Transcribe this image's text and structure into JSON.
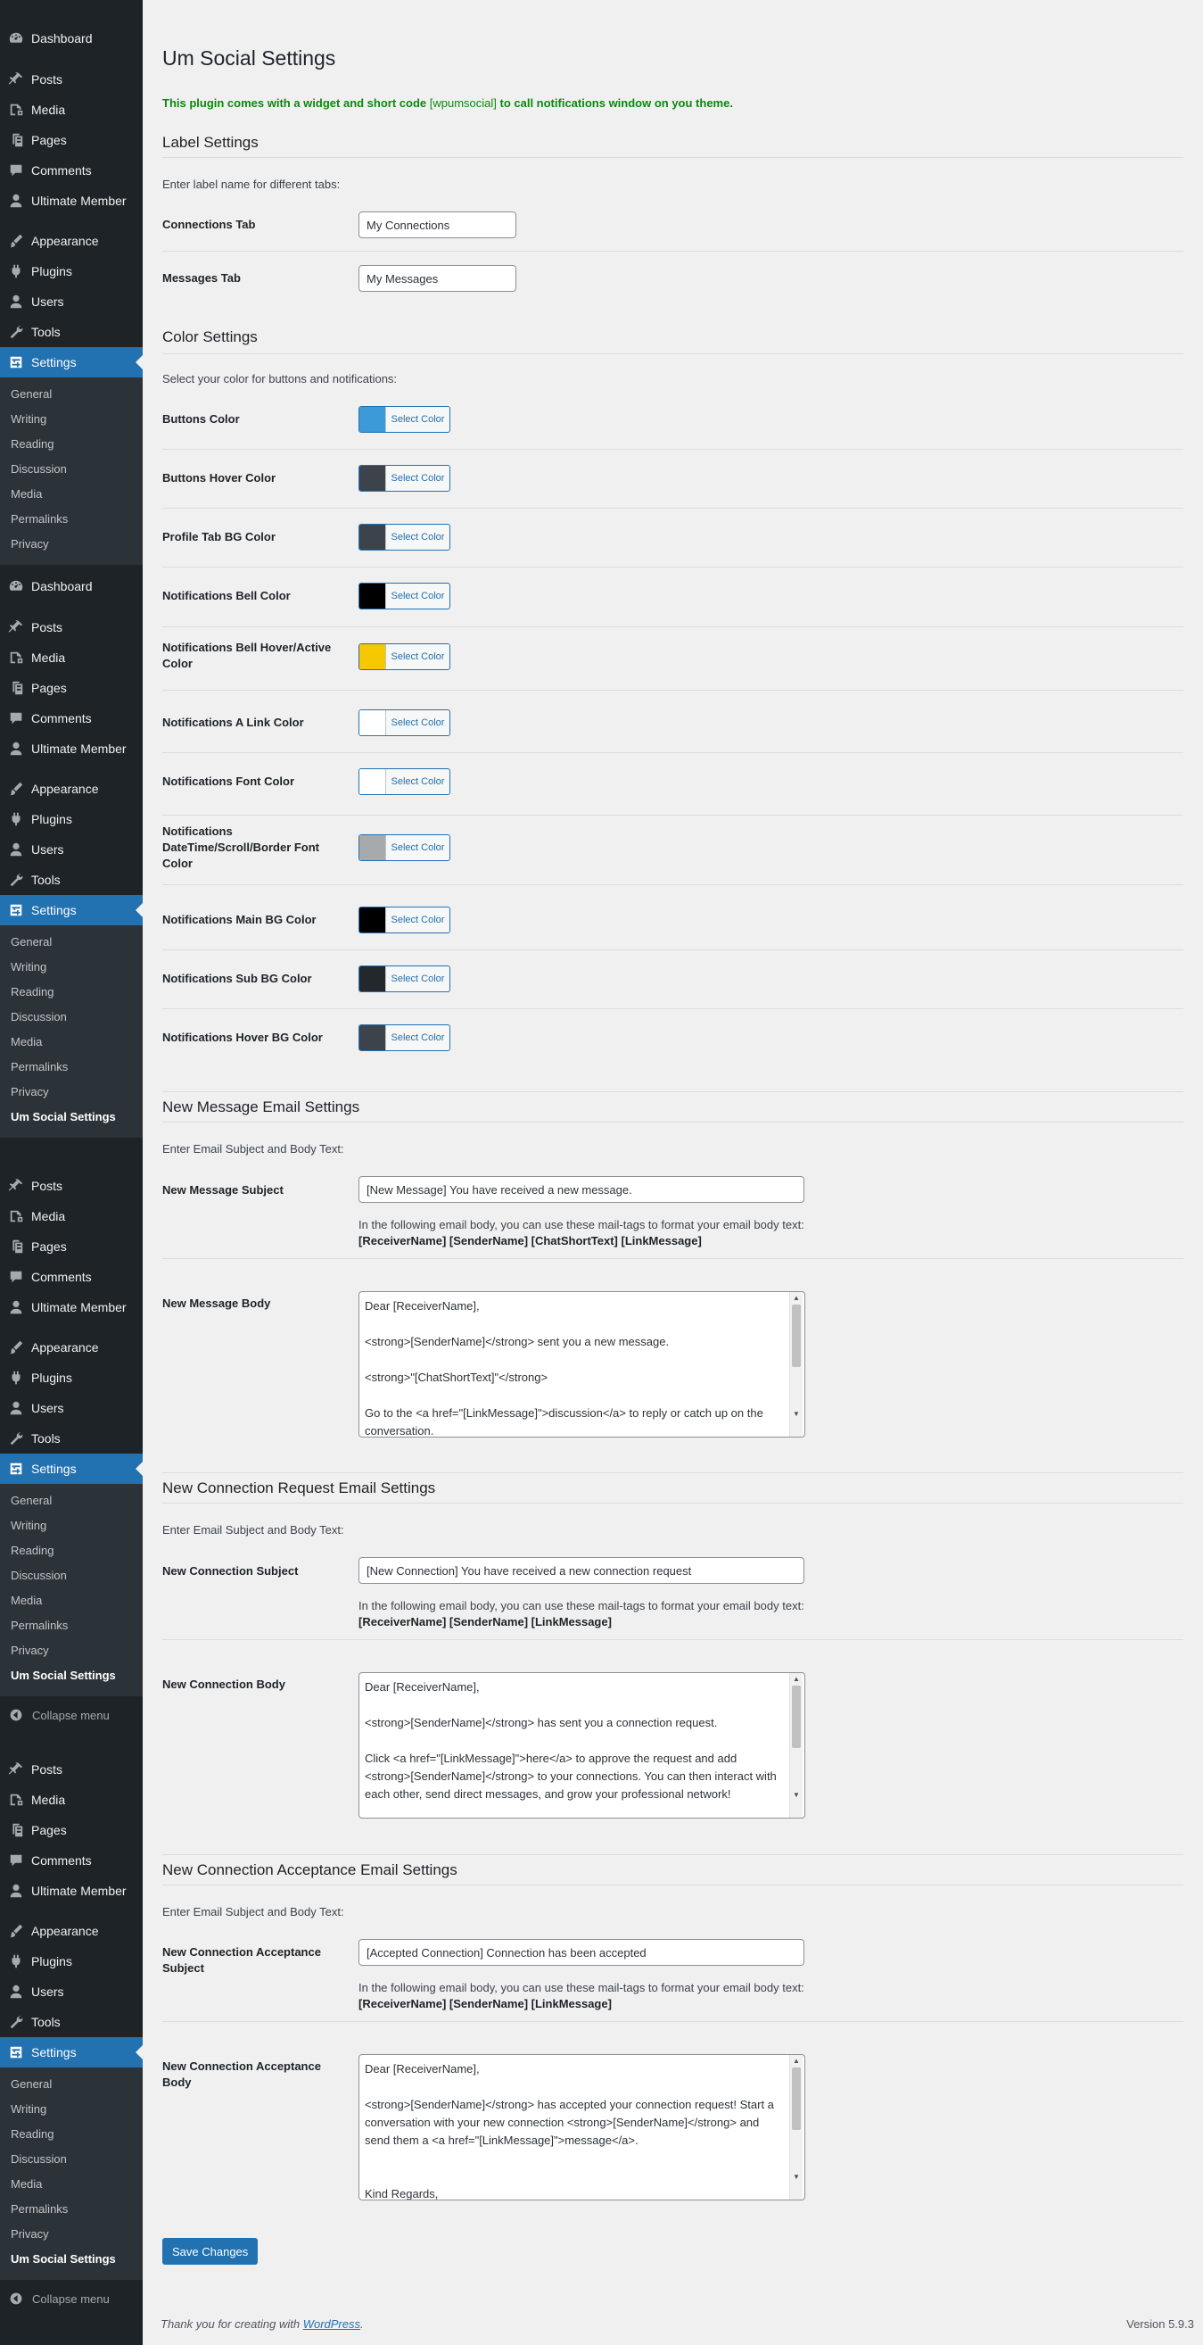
{
  "sidebar": {
    "blocks": [
      {
        "menu": [
          "Dashboard",
          "Posts",
          "Media",
          "Pages",
          "Comments",
          "Ultimate Member",
          "Appearance",
          "Plugins",
          "Users",
          "Tools",
          "Settings"
        ],
        "submenu": [
          "General",
          "Writing",
          "Reading",
          "Discussion",
          "Media",
          "Permalinks",
          "Privacy"
        ]
      },
      {
        "menu": [
          "Dashboard",
          "Posts",
          "Media",
          "Pages",
          "Comments",
          "Ultimate Member",
          "Appearance",
          "Plugins",
          "Users",
          "Tools",
          "Settings"
        ],
        "submenu": [
          "General",
          "Writing",
          "Reading",
          "Discussion",
          "Media",
          "Permalinks",
          "Privacy",
          "Um Social Settings"
        ]
      },
      {
        "menu": [
          "Posts",
          "Media",
          "Pages",
          "Comments",
          "Ultimate Member",
          "Appearance",
          "Plugins",
          "Users",
          "Tools",
          "Settings"
        ],
        "submenu": [
          "General",
          "Writing",
          "Reading",
          "Discussion",
          "Media",
          "Permalinks",
          "Privacy",
          "Um Social Settings"
        ],
        "collapse": "Collapse menu"
      },
      {
        "menu": [
          "Posts",
          "Media",
          "Pages",
          "Comments",
          "Ultimate Member",
          "Appearance",
          "Plugins",
          "Users",
          "Tools",
          "Settings"
        ],
        "submenu": [
          "General",
          "Writing",
          "Reading",
          "Discussion",
          "Media",
          "Permalinks",
          "Privacy",
          "Um Social Settings"
        ],
        "collapse": "Collapse menu"
      }
    ],
    "current_item": "Settings",
    "current_sub": "Um Social Settings"
  },
  "page": {
    "title": "Um Social Settings",
    "notice_pre": "This plugin comes with a widget and short code ",
    "notice_code": "[wpumsocial]",
    "notice_post": " to call notifications window on you theme."
  },
  "label_settings": {
    "title": "Label Settings",
    "desc": "Enter label name for different tabs:",
    "connections_label": "Connections Tab",
    "connections_value": "My Connections",
    "messages_label": "Messages Tab",
    "messages_value": "My Messages"
  },
  "color_settings": {
    "title": "Color Settings",
    "desc": "Select your color for buttons and notifications:",
    "button_label": "Select Color",
    "items": [
      {
        "label": "Buttons Color",
        "color": "#3c9ad8"
      },
      {
        "label": "Buttons Hover Color",
        "color": "#3c434a"
      },
      {
        "label": "Profile Tab BG Color",
        "color": "#3c434a"
      },
      {
        "label": "Notifications Bell Color",
        "color": "#000000"
      },
      {
        "label": "Notifications Bell Hover/Active Color",
        "color": "#f5c800"
      },
      {
        "label": "Notifications A Link Color",
        "color": "#ffffff"
      },
      {
        "label": "Notifications Font Color",
        "color": "#ffffff"
      },
      {
        "label": "Notifications DateTime/Scroll/Border Font Color",
        "color": "#a7aaad"
      },
      {
        "label": "Notifications Main BG Color",
        "color": "#000000"
      },
      {
        "label": "Notifications Sub BG Color",
        "color": "#23282d"
      },
      {
        "label": "Notifications Hover BG Color",
        "color": "#3c434a"
      }
    ]
  },
  "new_message": {
    "title": "New Message Email Settings",
    "desc": "Enter Email Subject and Body Text:",
    "subject_label": "New Message Subject",
    "subject_value": "[New Message] You have received a new message.",
    "hint": "In the following email body, you can use these mail-tags to format your email body text:",
    "tags": "[ReceiverName] [SenderName] [ChatShortText] [LinkMessage]",
    "body_label": "New Message Body",
    "body_value": "Dear [ReceiverName],\n\n<strong>[SenderName]</strong> sent you a new message.\n\n<strong>\"[ChatShortText]\"</strong>\n\nGo to the <a href=\"[LinkMessage]\">discussion</a> to reply or catch up on the conversation."
  },
  "new_connection": {
    "title": "New Connection Request Email Settings",
    "desc": "Enter Email Subject and Body Text:",
    "subject_label": "New Connection Subject",
    "subject_value": "[New Connection] You have received a new connection request",
    "hint": "In the following email body, you can use these mail-tags to format your email body text:",
    "tags": "[ReceiverName] [SenderName] [LinkMessage]",
    "body_label": "New Connection Body",
    "body_value": "Dear [ReceiverName],\n\n<strong>[SenderName]</strong> has sent you a connection request.\n\nClick <a href=\"[LinkMessage]\">here</a> to approve the request and add <strong>[SenderName]</strong> to your connections. You can then interact with each other, send direct messages, and grow your professional network!"
  },
  "connection_accept": {
    "title": "New Connection Acceptance Email Settings",
    "desc": "Enter Email Subject and Body Text:",
    "subject_label": "New Connection Acceptance Subject",
    "subject_value": "[Accepted Connection] Connection has been accepted",
    "hint": "In the following email body, you can use these mail-tags to format your email body text:",
    "tags": "[ReceiverName] [SenderName] [LinkMessage]",
    "body_label": "New Connection Acceptance Body",
    "body_value": "Dear [ReceiverName],\n\n<strong>[SenderName]</strong> has accepted your connection request! Start a conversation with your new connection <strong>[SenderName]</strong> and send them a <a href=\"[LinkMessage]\">message</a>.\n\n\nKind Regards,"
  },
  "save_label": "Save Changes",
  "footer": {
    "thanks_pre": "Thank you for creating with ",
    "thanks_link": "WordPress",
    "thanks_post": ".",
    "version": "Version 5.9.3"
  },
  "colors": {
    "accent": "#2271b1",
    "sidebar": "#1d2327",
    "submenu": "#2c3338",
    "notice": "#0a8a0a"
  }
}
